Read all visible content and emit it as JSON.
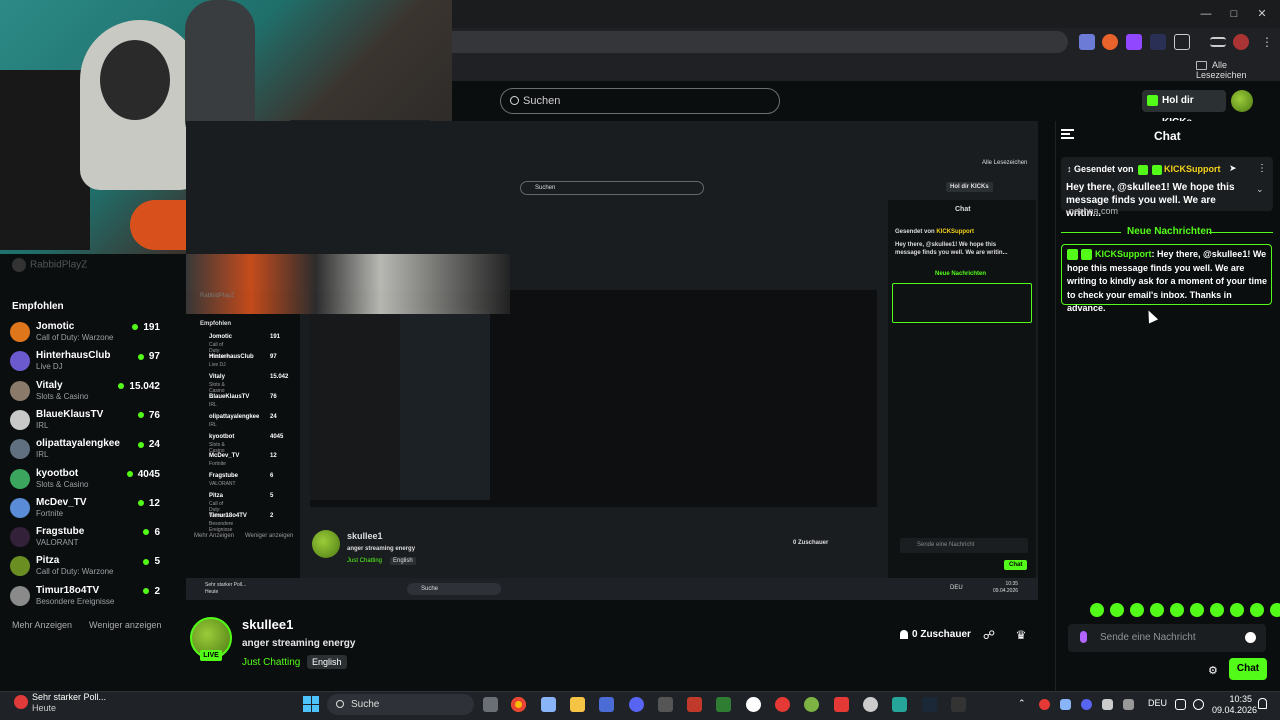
{
  "browser": {
    "bookmarks_label": "Alle Lesezeichen",
    "window_controls": [
      "minimize",
      "maximize",
      "close"
    ]
  },
  "kick": {
    "search_placeholder": "Suchen",
    "get_kicks_button": "Hol dir KICKs"
  },
  "sidebar": {
    "user": "RabbidPlayZ",
    "heading": "Empfohlen",
    "channels": [
      {
        "name": "Jomotic",
        "category": "Call of Duty: Warzone",
        "viewers": "191",
        "color": "#e0761c"
      },
      {
        "name": "HinterhausClub",
        "category": "Live DJ",
        "viewers": "97",
        "color": "#6a5acd"
      },
      {
        "name": "Vitaly",
        "category": "Slots & Casino",
        "viewers": "15.042",
        "color": "#8a7a6a"
      },
      {
        "name": "BlaueKlausTV",
        "category": "IRL",
        "viewers": "76",
        "color": "#c8c8c8"
      },
      {
        "name": "olipattayalengkee",
        "category": "IRL",
        "viewers": "24",
        "color": "#607080"
      },
      {
        "name": "kyootbot",
        "category": "Slots & Casino",
        "viewers": "4045",
        "color": "#3ba55d"
      },
      {
        "name": "McDev_TV",
        "category": "Fortnite",
        "viewers": "12",
        "color": "#5a8bd6"
      },
      {
        "name": "Fragstube",
        "category": "VALORANT",
        "viewers": "6",
        "color": "#33213a"
      },
      {
        "name": "Pitza",
        "category": "Call of Duty: Warzone",
        "viewers": "5",
        "color": "#6b8e23"
      },
      {
        "name": "Timur18o4TV",
        "category": "Besondere Ereignisse",
        "viewers": "2",
        "color": "#8a8a8a"
      }
    ],
    "show_more": "Mehr Anzeigen",
    "show_less": "Weniger anzeigen"
  },
  "video_mirror": {
    "bookmarks_label": "Alle Lesezeichen",
    "search_placeholder": "Suchen",
    "get_kicks_button": "Hol dir KICKs",
    "user": "RabbidPlayZ",
    "chat_title": "Chat",
    "pinned_by": "Gesendet von",
    "pinned_user": "KICKSupport",
    "pinned_text": "Hey there, @skullee1! We hope this message finds you well. We are writin...",
    "new_messages": "Neue Nachrichten",
    "streamer": "skullee1",
    "title": "anger streaming energy",
    "category": "Just Chatting",
    "language": "English",
    "viewers": "0 Zuschauer",
    "chat_placeholder": "Sende eine Nachricht",
    "chat_button": "Chat",
    "taskbar_search": "Suche",
    "clock_time": "10:35",
    "clock_date": "09.04.2026",
    "lang": "DEU",
    "poll_title": "Sehr starker Poll...",
    "poll_sub": "Heute",
    "channels": [
      {
        "name": "Jomotic",
        "viewers": "191",
        "category": "Call of Duty: Warzone"
      },
      {
        "name": "HinterhausClub",
        "viewers": "97",
        "category": "Live DJ"
      },
      {
        "name": "Vitaly",
        "viewers": "15.042",
        "category": "Slots & Casino"
      },
      {
        "name": "BlaueKlausTV",
        "viewers": "76",
        "category": "IRL"
      },
      {
        "name": "olipattayalengkee",
        "viewers": "24",
        "category": "IRL"
      },
      {
        "name": "kyootbot",
        "viewers": "4045",
        "category": "Slots & Casino"
      },
      {
        "name": "McDev_TV",
        "viewers": "12",
        "category": "Fortnite"
      },
      {
        "name": "Fragstube",
        "viewers": "6",
        "category": "VALORANT"
      },
      {
        "name": "Pitza",
        "viewers": "5",
        "category": "Call of Duty: Warzone"
      },
      {
        "name": "Timur18o4TV",
        "viewers": "2",
        "category": "Besondere Ereignisse"
      }
    ],
    "show_more": "Mehr Anzeigen",
    "show_less": "Weniger anzeigen"
  },
  "stream": {
    "streamer": "skullee1",
    "live_badge": "LIVE",
    "title": "anger streaming energy",
    "category": "Just Chatting",
    "language": "English",
    "viewers": "0 Zuschauer"
  },
  "chat": {
    "title": "Chat",
    "pinned": {
      "sent_by": "Gesendet von",
      "user": "KICKSupport",
      "text": "Hey there, @skullee1! We hope this message finds you well. We are writin...",
      "peek": "-nezhna.com"
    },
    "new_messages_label": "Neue Nachrichten",
    "message": {
      "user": "KICKSupport",
      "text": ": Hey there, @skullee1! We hope this message finds you well. We are writing to kindly ask for a moment of your time to check your email's inbox. Thanks in advance."
    },
    "input_placeholder": "Sende eine Nachricht",
    "send_button": "Chat"
  },
  "taskbar": {
    "notification_title": "Sehr starker Poll...",
    "notification_sub": "Heute",
    "search_label": "Suche",
    "language": "DEU",
    "time": "10:35",
    "date": "09.04.2026"
  },
  "colors": {
    "accent": "#53fc18",
    "background": "#0b0e0f",
    "username_yellow": "#f4d21b"
  }
}
